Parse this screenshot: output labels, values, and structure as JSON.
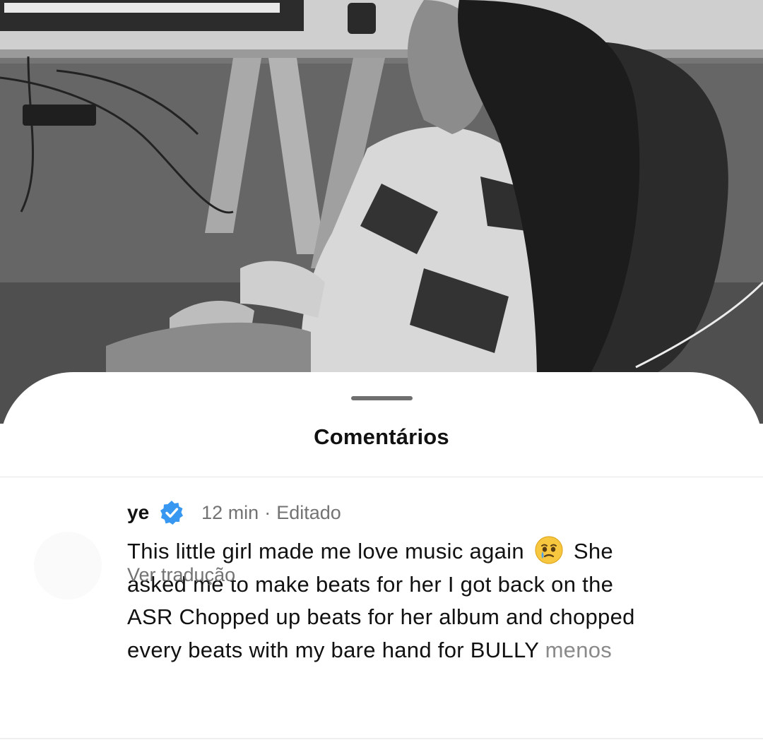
{
  "sheet": {
    "title": "Comentários"
  },
  "comment": {
    "username": "ye",
    "time": "12 min",
    "separator": "·",
    "edited": "Editado",
    "text_lines": [
      "This little girl made me love music again",
      "She",
      "asked me to make beats for her  I got back on the",
      "ASR  Chopped up beats for her album  and chopped",
      "every beats with my bare hand for BULLY"
    ],
    "less_label": "menos",
    "translate_label": "Ver tradução",
    "emoji": "face-holding-back-tears"
  },
  "colors": {
    "verified": "#3897f0",
    "muted": "#737373",
    "text": "#111111"
  }
}
